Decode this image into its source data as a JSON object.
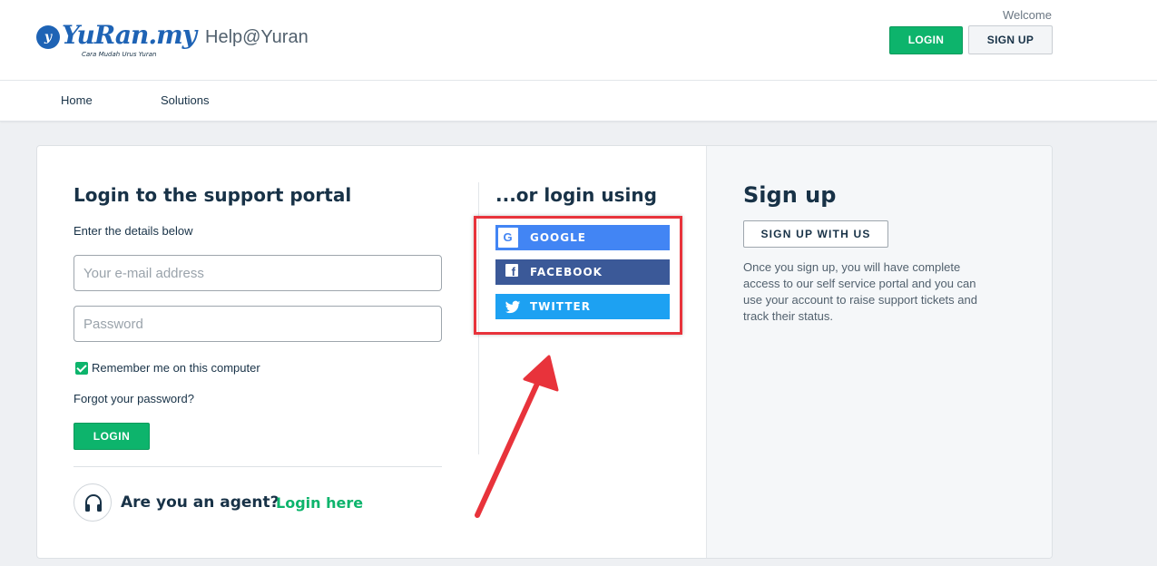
{
  "header": {
    "logo": {
      "mark": "y",
      "name": "YuRan.my",
      "tagline": "Cara Mudah Urus Yuran"
    },
    "portal_name": "Help@Yuran",
    "welcome": "Welcome",
    "login_label": "LOGIN",
    "signup_label": "SIGN UP"
  },
  "nav": {
    "items": [
      {
        "label": "Home"
      },
      {
        "label": "Solutions"
      }
    ]
  },
  "login": {
    "title": "Login to the support portal",
    "subtitle": "Enter the details below",
    "email_placeholder": "Your e-mail address",
    "password_placeholder": "Password",
    "remember_label": "Remember me on this computer",
    "remember_checked": true,
    "forgot_label": "Forgot your password?",
    "button_label": "LOGIN"
  },
  "agent": {
    "question": "Are you an agent?",
    "link": "Login here",
    "icon": "headphones-icon"
  },
  "social": {
    "title": "...or login using",
    "buttons": [
      {
        "label": "GOOGLE",
        "icon": "google-icon",
        "color": "#4285f4"
      },
      {
        "label": "FACEBOOK",
        "icon": "facebook-icon",
        "color": "#3b5998"
      },
      {
        "label": "TWITTER",
        "icon": "twitter-icon",
        "color": "#1da1f2"
      }
    ]
  },
  "signup": {
    "title": "Sign up",
    "button_label": "SIGN UP WITH US",
    "description": "Once you sign up, you will have complete access to our self service portal and you can use your account to raise support tickets and track their status."
  },
  "colors": {
    "primary_green": "#0db46c",
    "text_dark": "#183247",
    "annotation_red": "#e8333b"
  }
}
